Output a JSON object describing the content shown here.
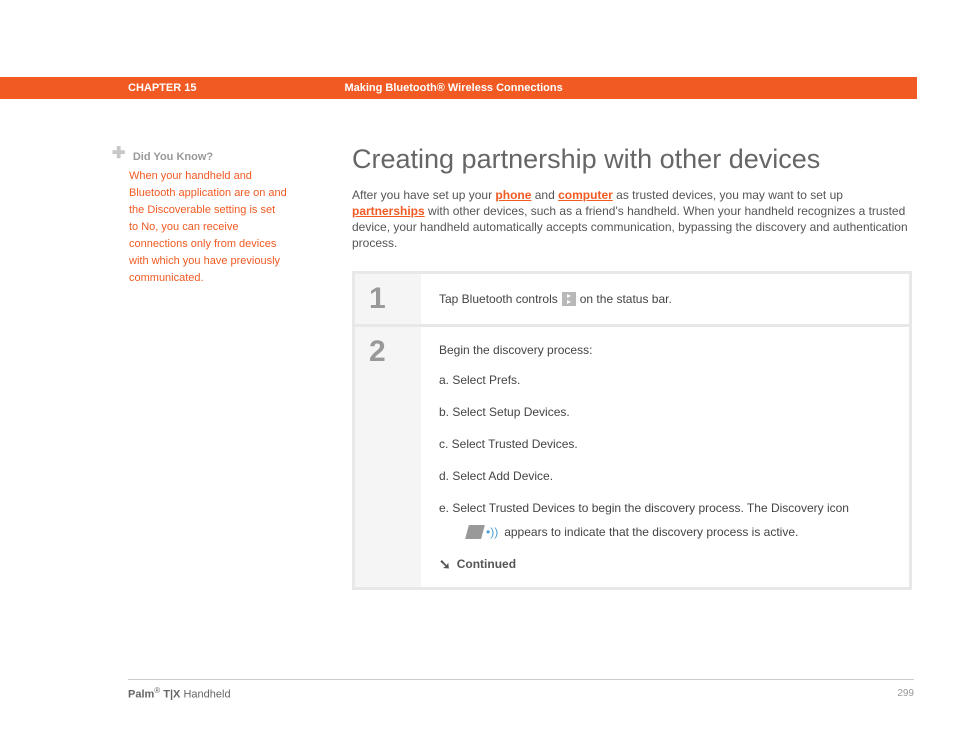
{
  "header": {
    "chapter": "CHAPTER 15",
    "title": "Making Bluetooth® Wireless Connections"
  },
  "sidebar": {
    "label": "Did You Know?",
    "text": "When your handheld and Bluetooth application are on and the Discoverable setting is set to No, you can receive connections only from devices with which you have previously communicated."
  },
  "main": {
    "title": "Creating partnership with other devices",
    "intro_pre": "After you have set up your ",
    "link_phone": "phone",
    "intro_and": " and ",
    "link_computer": "computer",
    "intro_mid": " as trusted devices, you may want to set up ",
    "link_partnerships": "partnerships",
    "intro_post": " with other devices, such as a friend's handheld. When your handheld recognizes a trusted device, your handheld automatically accepts communication, bypassing the discovery and authentication process."
  },
  "steps": {
    "s1_num": "1",
    "s1_pre": "Tap Bluetooth controls ",
    "s1_post": " on the status bar.",
    "s2_num": "2",
    "s2_intro": "Begin the discovery process:",
    "s2_a": "a.  Select Prefs.",
    "s2_b": "b.  Select Setup Devices.",
    "s2_c": "c.  Select Trusted Devices.",
    "s2_d": "d.  Select Add Device.",
    "s2_e": "e.  Select Trusted Devices to begin the discovery process. The Discovery icon",
    "s2_e2": "appears to indicate that the discovery process is active.",
    "continued": "Continued"
  },
  "footer": {
    "brand": "Palm",
    "reg": "®",
    "model": " T|X",
    "device": " Handheld",
    "page": "299"
  }
}
